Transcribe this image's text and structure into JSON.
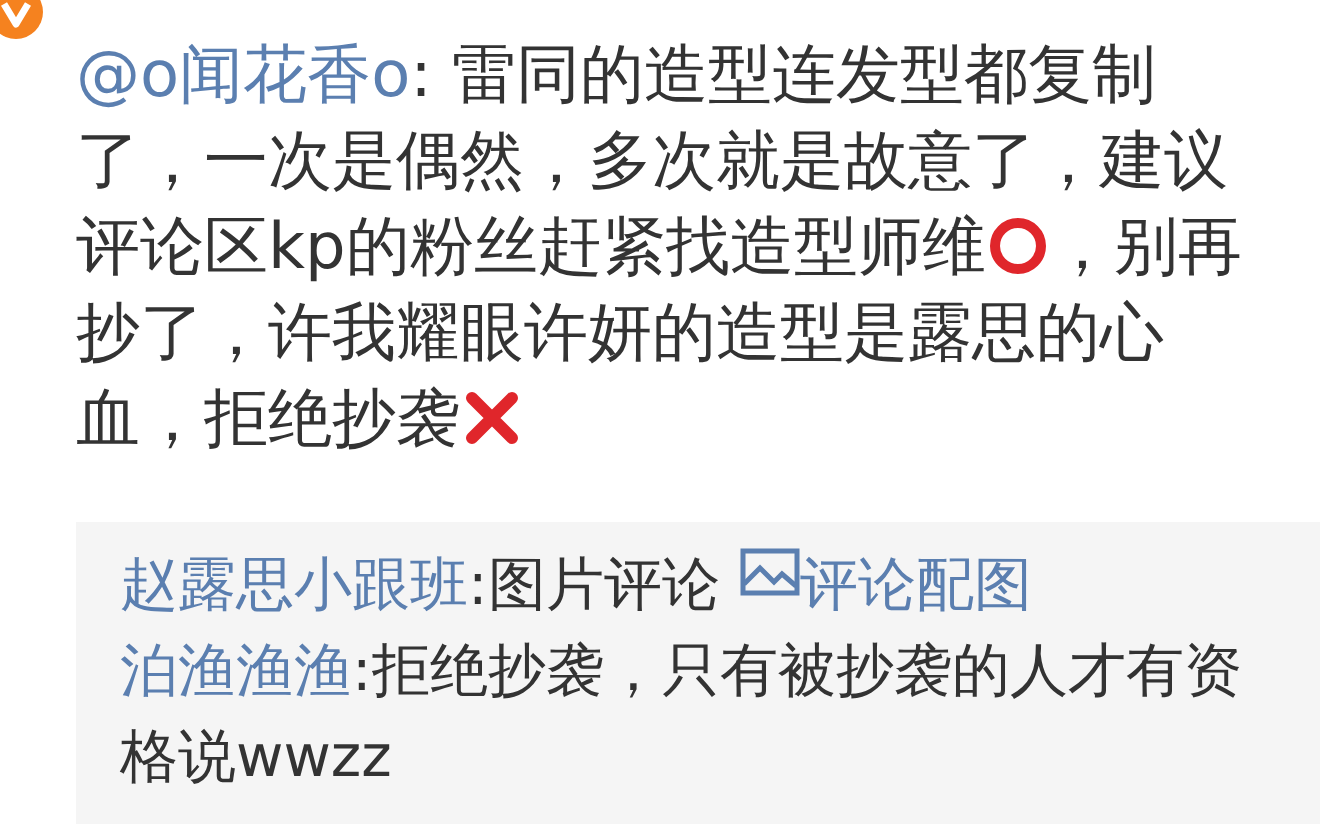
{
  "comment": {
    "mention": "@o闻花香o",
    "segments": [
      {
        "kind": "text",
        "text": ": 雷同的造型连发型都复制了，一次是偶然，多次就是故意了，建议评论区kp的粉丝赶紧找造型师维"
      },
      {
        "kind": "circle"
      },
      {
        "kind": "text",
        "text": "，别再抄了，许我耀眼许妍的造型是露思的心血，拒绝抄袭"
      },
      {
        "kind": "cross"
      }
    ]
  },
  "replies": [
    {
      "author": "赵露思小跟班",
      "text": ":图片评论",
      "attachment": {
        "label": "评论配图"
      }
    },
    {
      "author": "泊渔渔渔",
      "text": ":拒绝抄袭，只有被抄袭的人才有资格说wwzz"
    }
  ]
}
